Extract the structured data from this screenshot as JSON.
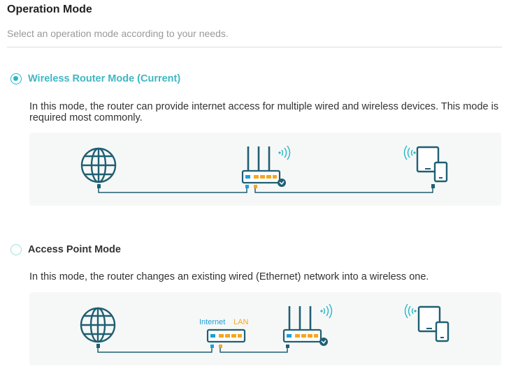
{
  "page": {
    "title": "Operation Mode",
    "subtitle": "Select an operation mode according to your needs."
  },
  "modes": [
    {
      "label": "Wireless Router Mode (Current)",
      "selected": true,
      "description": "In this mode, the router can provide internet access for multiple wired and wireless devices. This mode is required most commonly."
    },
    {
      "label": "Access Point Mode",
      "selected": false,
      "description": "In this mode, the router changes an existing wired (Ethernet) network into a wireless one.",
      "diagram_labels": {
        "internet": "Internet",
        "lan": "LAN"
      }
    }
  ],
  "colors": {
    "accent": "#28b6c6",
    "icon": "#1f5f73",
    "lan": "#f5a623",
    "wan": "#1e9ed8"
  }
}
